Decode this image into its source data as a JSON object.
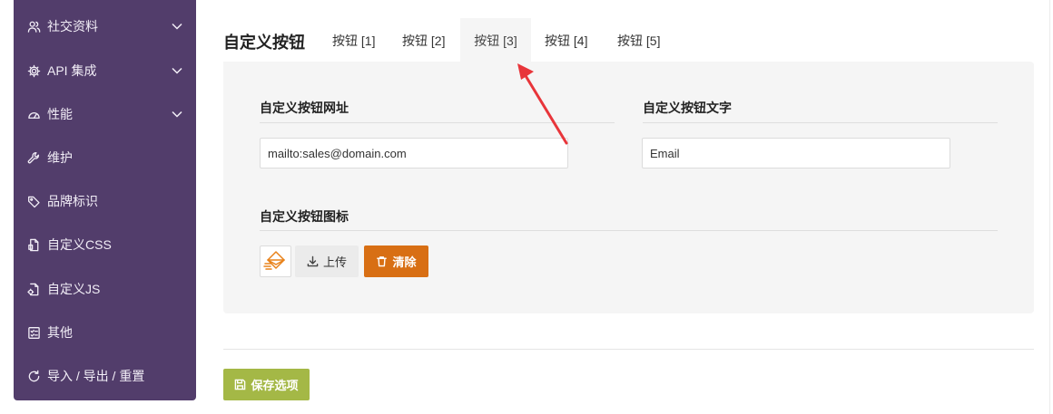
{
  "sidebar": {
    "items": [
      {
        "label": "社交资料",
        "icon": "users-icon",
        "expandable": true
      },
      {
        "label": "API 集成",
        "icon": "gear-icon",
        "expandable": true
      },
      {
        "label": "性能",
        "icon": "gauge-icon",
        "expandable": true
      },
      {
        "label": "维护",
        "icon": "wrench-icon",
        "expandable": false
      },
      {
        "label": "品牌标识",
        "icon": "tag-icon",
        "expandable": false
      },
      {
        "label": "自定义CSS",
        "icon": "css-file-icon",
        "expandable": false
      },
      {
        "label": "自定义JS",
        "icon": "js-file-icon",
        "expandable": false
      },
      {
        "label": "其他",
        "icon": "checklist-icon",
        "expandable": false
      },
      {
        "label": "导入 / 导出 / 重置",
        "icon": "refresh-icon",
        "expandable": false
      }
    ]
  },
  "section": {
    "title": "自定义按钮",
    "tabs": [
      {
        "label": "按钮 [1]",
        "active": false
      },
      {
        "label": "按钮 [2]",
        "active": false
      },
      {
        "label": "按钮 [3]",
        "active": true
      },
      {
        "label": "按钮 [4]",
        "active": false
      },
      {
        "label": "按钮 [5]",
        "active": false
      }
    ]
  },
  "form": {
    "url_label": "自定义按钮网址",
    "url_value": "mailto:sales@domain.com",
    "text_label": "自定义按钮文字",
    "text_value": "Email",
    "icon_label": "自定义按钮图标",
    "upload_label": "上传",
    "clear_label": "清除"
  },
  "footer": {
    "save_label": "保存选项"
  },
  "colors": {
    "sidebar_bg": "#523d6b",
    "clear_button": "#d86f14",
    "save_button": "#a4b846",
    "annotation_arrow": "#e8353a"
  }
}
